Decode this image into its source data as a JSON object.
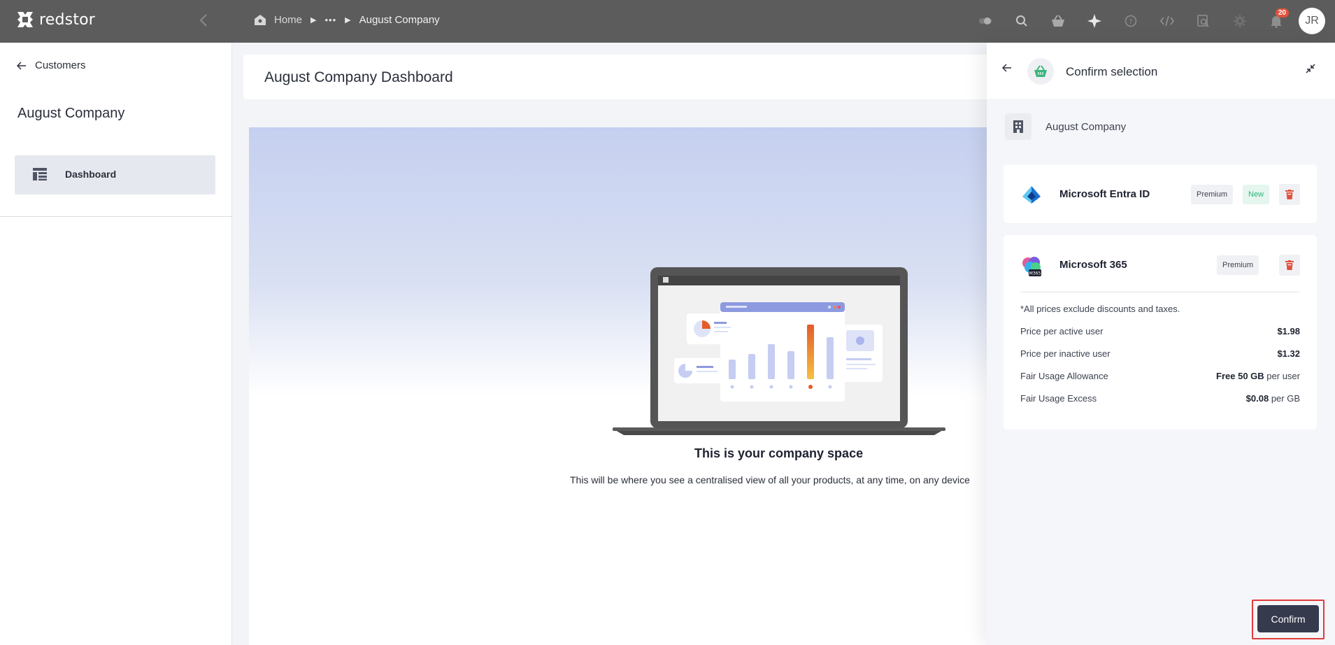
{
  "app": {
    "logo_text": "redstor"
  },
  "breadcrumb": {
    "home": "Home",
    "ellipsis": "•••",
    "current": "August Company"
  },
  "topbar": {
    "icons": [
      "toggle-icon",
      "search-icon",
      "basket-icon",
      "sparkle-icon",
      "help-icon",
      "code-icon",
      "inspect-icon",
      "settings-icon",
      "bell-icon"
    ],
    "notification_count": "20",
    "avatar_initials": "JR"
  },
  "sidebar": {
    "back_label": "Customers",
    "company": "August Company",
    "items": [
      {
        "label": "Dashboard",
        "icon": "dashboard-icon",
        "active": true
      }
    ]
  },
  "main": {
    "title": "August Company Dashboard",
    "hero_title": "This is your company space",
    "hero_subtitle": "This will be where you see a centralised view of all your products, at any time, on any device"
  },
  "drawer": {
    "title": "Confirm selection",
    "company": "August Company",
    "products": [
      {
        "name": "Microsoft Entra ID",
        "tier": "Premium",
        "status": "New"
      },
      {
        "name": "Microsoft 365",
        "tier": "Premium"
      }
    ],
    "note": "*All prices exclude discounts and taxes.",
    "prices": [
      {
        "label": "Price per active user",
        "value": "$1.98",
        "suffix": ""
      },
      {
        "label": "Price per inactive user",
        "value": "$1.32",
        "suffix": ""
      },
      {
        "label": "Fair Usage Allowance",
        "value": "Free 50 GB",
        "suffix": " per user"
      },
      {
        "label": "Fair Usage Excess",
        "value": "$0.08",
        "suffix": " per GB"
      }
    ],
    "confirm_label": "Confirm"
  },
  "colors": {
    "topbar": "#5c5c5c",
    "confirm": "#363a4d",
    "highlight": "#e03a3a",
    "new_tag": "#2fb37a",
    "trash": "#e0523d"
  }
}
